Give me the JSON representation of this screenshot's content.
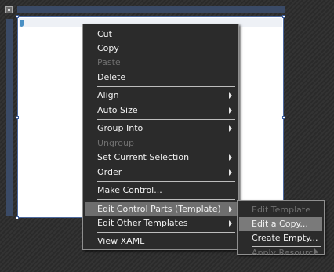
{
  "icons": {
    "grip": "square-grip-icon",
    "anchor": "anchor-marker-icon",
    "submenu": "chevron-right-icon"
  },
  "colors": {
    "menu_bg": "#2b2b2b",
    "menu_text": "#f2f2f2",
    "disabled_text": "#6f6f6f",
    "highlight": "#6e6e6e",
    "canvas": "#ffffff",
    "ruler": "#3a4a66"
  },
  "context_menu": {
    "cut": "Cut",
    "copy": "Copy",
    "paste": "Paste",
    "delete": "Delete",
    "align": "Align",
    "auto_size": "Auto Size",
    "group_into": "Group Into",
    "ungroup": "Ungroup",
    "set_current_selection": "Set Current Selection",
    "order": "Order",
    "make_control": "Make Control...",
    "edit_control_parts": "Edit Control Parts (Template)",
    "edit_other_templates": "Edit Other Templates",
    "view_xaml": "View XAML"
  },
  "submenu": {
    "edit_template": "Edit Template",
    "edit_a_copy": "Edit a Copy...",
    "create_empty": "Create Empty...",
    "apply_resource": "Apply Resource"
  }
}
